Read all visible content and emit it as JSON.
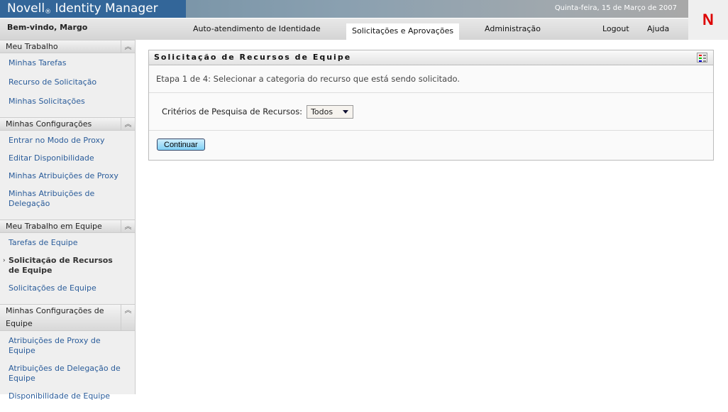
{
  "header": {
    "brand": "Novell",
    "brand_mark": "®",
    "product": "Identity Manager",
    "date": "Quinta-feira, 15 de Março de 2007",
    "logo": "N",
    "welcome": "Bem-vindo, Margo"
  },
  "nav": {
    "tabs": [
      "Auto-atendimento de Identidade",
      "Solicitações e Aprovações",
      "Administração"
    ],
    "active": "Solicitações e Aprovações",
    "logout": "Logout",
    "help": "Ajuda"
  },
  "sidebar": {
    "sections": [
      {
        "title": "Meu Trabalho",
        "items": [
          "Minhas Tarefas",
          "Recurso de Solicitação",
          "Minhas Solicitações"
        ]
      },
      {
        "title": "Minhas Configurações",
        "items": [
          "Entrar no Modo de Proxy",
          "Editar Disponibilidade",
          "Minhas Atribuições de Proxy",
          "Minhas Atribuições de Delegação"
        ]
      },
      {
        "title": "Meu Trabalho em Equipe",
        "items": [
          "Tarefas de Equipe",
          "Solicitação de Recursos de Equipe",
          "Solicitações de Equipe"
        ]
      },
      {
        "title": "Minhas Configurações de Equipe",
        "items": [
          "Atribuições de Proxy de Equipe",
          "Atribuições de Delegação de Equipe",
          "Disponibilidade de Equipe"
        ]
      }
    ],
    "current": "Solicitação de Recursos de Equipe",
    "collapse_icon": "double-chevron-up"
  },
  "panel": {
    "title": "Solicitação de Recursos de Equipe",
    "step": "Etapa 1 de 4: Selecionar a categoria do recurso que está sendo solicitado.",
    "criteria_label": "Critérios de Pesquisa de Recursos:",
    "criteria_value": "Todos",
    "continue": "Continuar"
  },
  "colors": {
    "brand_blue": "#336699",
    "link": "#2a5c9a",
    "logo_red": "#dd0000"
  }
}
